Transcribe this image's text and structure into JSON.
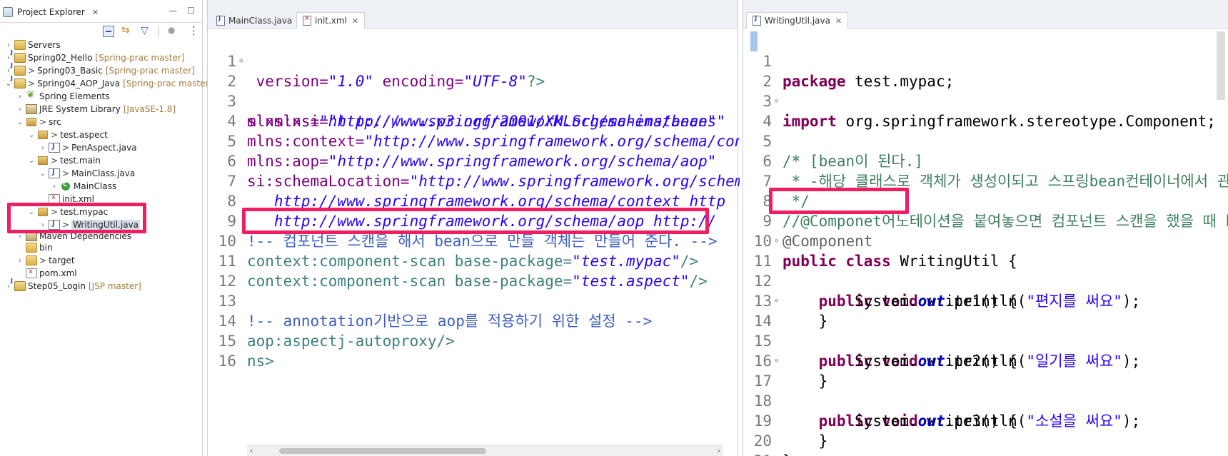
{
  "explorer": {
    "title": "Project Explorer",
    "close_glyph": "✕",
    "minimize_glyph": "—",
    "maximize_glyph": "☐",
    "items": [
      {
        "label": "Servers",
        "decoration": "",
        "prefix": ""
      },
      {
        "label": "Spring02_Hello",
        "decoration": "[Spring-prac master]",
        "prefix": ""
      },
      {
        "label": "Spring03_Basic",
        "decoration": "[Spring-prac master]",
        "prefix": ">"
      },
      {
        "label": "Spring04_AOP_Java",
        "decoration": "[Spring-prac master]",
        "prefix": ">"
      },
      {
        "label": "Spring Elements",
        "decoration": "",
        "prefix": ""
      },
      {
        "label": "JRE System Library",
        "decoration": "[JavaSE-1.8]",
        "prefix": ""
      },
      {
        "label": "src",
        "decoration": "",
        "prefix": ">"
      },
      {
        "label": "test.aspect",
        "decoration": "",
        "prefix": ">"
      },
      {
        "label": "PenAspect.java",
        "decoration": "",
        "prefix": ">"
      },
      {
        "label": "test.main",
        "decoration": "",
        "prefix": ">"
      },
      {
        "label": "MainClass.java",
        "decoration": "",
        "prefix": ">"
      },
      {
        "label": "MainClass",
        "decoration": "",
        "prefix": ""
      },
      {
        "label": "init.xml",
        "decoration": "",
        "prefix": ""
      },
      {
        "label": "test.mypac",
        "decoration": "",
        "prefix": ">"
      },
      {
        "label": "WritingUtil.java",
        "decoration": "",
        "prefix": ">"
      },
      {
        "label": "Maven Dependencies",
        "decoration": "",
        "prefix": ""
      },
      {
        "label": "bin",
        "decoration": "",
        "prefix": ""
      },
      {
        "label": "target",
        "decoration": "",
        "prefix": ">"
      },
      {
        "label": "pom.xml",
        "decoration": "",
        "prefix": ""
      },
      {
        "label": "Step05_Login",
        "decoration": "[JSP master]",
        "prefix": ""
      }
    ]
  },
  "left_editor": {
    "tabs": [
      {
        "label": "MainClass.java"
      },
      {
        "label": "init.xml",
        "close": "✕"
      }
    ],
    "line_numbers": [
      "1",
      "2",
      "3",
      "4",
      "5",
      "6",
      "7",
      "8",
      "9",
      "10",
      "11",
      "12",
      "13",
      "14",
      "15",
      "16"
    ],
    "lines": {
      "l1": [
        " version=",
        "\"1.0\"",
        " encoding=",
        "\"UTF-8\"",
        "?>"
      ],
      "l2": [
        "s xmlns=",
        "\"http://www.springframework.org/schema/beans\""
      ],
      "l3": [
        "mlns:xsi=",
        "\"http://www.w3.org/2001/XMLSchema-instance\""
      ],
      "l4": [
        "mlns:context=",
        "\"http://www.springframework.org/schema/context\""
      ],
      "l5": [
        "mlns:aop=",
        "\"http://www.springframework.org/schema/aop\""
      ],
      "l6": [
        "si:schemaLocation=",
        "\"http://www.springframework.org/schema/beans"
      ],
      "l7": [
        "   http://www.springframework.org/schema/context http"
      ],
      "l8": [
        "   http://www.springframework.org/schema/aop http://"
      ],
      "l9": [
        "!-- 컴포넌트 스캔을 해서 bean으로 만들 객체는 만들어 준다. -->"
      ],
      "l10": [
        "context:component-scan base-package=",
        "\"test.mypac\"",
        "/>"
      ],
      "l11": [
        "context:component-scan base-package=",
        "\"test.aspect\"",
        "/>"
      ],
      "l12": [
        ""
      ],
      "l13": [
        "!-- annotation기반으로 aop를 적용하기 위한 설정 -->"
      ],
      "l14": [
        "aop:aspectj-autoproxy/>"
      ],
      "l15": [
        "ns>"
      ],
      "l16": [
        ""
      ]
    }
  },
  "right_editor": {
    "tabs": [
      {
        "label": "WritingUtil.java",
        "close": "✕"
      }
    ],
    "line_numbers": [
      "1",
      "2",
      "3",
      "4",
      "5",
      "6",
      "7",
      "8",
      "9",
      "10",
      "11",
      "12",
      "13",
      "14",
      "15",
      "16",
      "17",
      "18",
      "19",
      "20",
      "21"
    ],
    "lines": {
      "l1": [
        "package",
        " test.mypac;"
      ],
      "l2": [
        ""
      ],
      "l3": [
        "import",
        " org.springframework.stereotype.Component;"
      ],
      "l4": [
        "/*"
      ],
      "l5": [
        " * [bean이 된다.]"
      ],
      "l6": [
        " * -해당 클래스로 객체가 생성이되고 스프링bean컨테이너에서 관리가 된다."
      ],
      "l7": [
        " */"
      ],
      "l8": [
        "//@Componet어노테이션을 붙여놓으면 컴포넌트 스캔을 했을 때 bean이 된다."
      ],
      "l9": [
        "@Component"
      ],
      "l10": [
        "public",
        " ",
        "class",
        " WritingUtil {"
      ],
      "l11": [
        "    ",
        "public",
        " ",
        "void",
        " write1() {"
      ],
      "l12": [
        "        System.",
        "out",
        ".println(",
        "\"편지를 써요\"",
        ");"
      ],
      "l13": [
        "    }"
      ],
      "l14": [
        "    ",
        "public",
        " ",
        "void",
        " write2() {"
      ],
      "l15": [
        "        System.",
        "out",
        ".println(",
        "\"일기를 써요\"",
        ");"
      ],
      "l16": [
        "    }"
      ],
      "l17": [
        "    ",
        "public",
        " ",
        "void",
        " write3() {"
      ],
      "l18": [
        "        System.",
        "out",
        ".println(",
        "\"소설을 써요\"",
        ");"
      ],
      "l19": [
        "    }"
      ],
      "l20": [
        "}"
      ],
      "l21": [
        ""
      ]
    }
  },
  "colors": {
    "highlight": "#f01d61",
    "keyword": "#7f0055",
    "string": "#2a00ff",
    "comment": "#3f7f5f",
    "xml_comment": "#3f5fbf",
    "annotation": "#646464"
  }
}
